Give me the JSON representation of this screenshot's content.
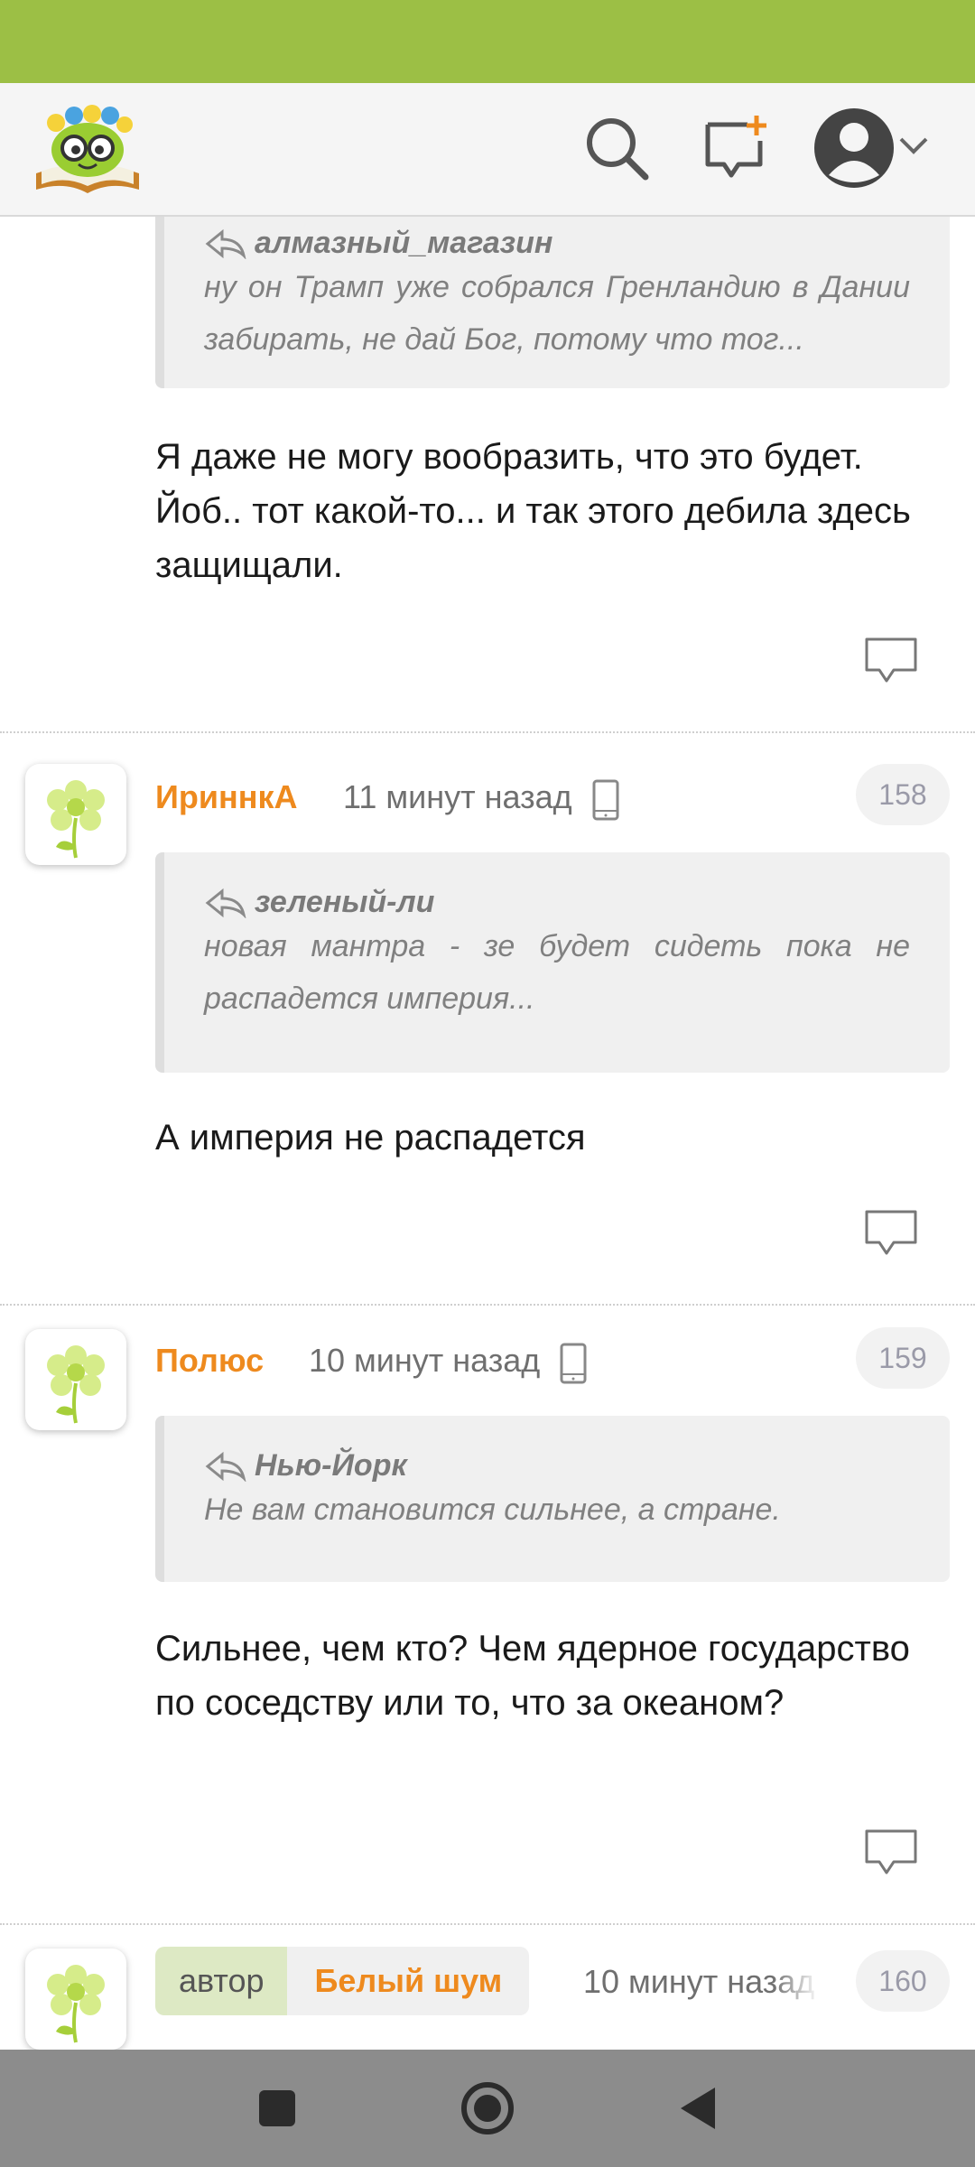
{
  "header": {
    "logo": "smiling-book-logo",
    "search_icon": "search-icon",
    "new_message_icon": "new-message-icon",
    "profile_icon": "profile-icon"
  },
  "comments": [
    {
      "quote_author": "алмазный_магазин",
      "quote_text": "ну он Трамп уже собрался Гренландию в Дании забирать, не дай Бог, потому что тог...",
      "text": "Я даже не могу вообразить, что это будет. Йоб.. тот какой-то... и так этого дебила здесь защищали."
    },
    {
      "username": "ИриннкА",
      "time": "11 минут назад",
      "number": "158",
      "quote_author": "зеленый-ли",
      "quote_text": "новая мантра - зе будет сидеть пока не распадется империя...",
      "text": "А империя не распадется"
    },
    {
      "username": "Полюс",
      "time": "10 минут назад",
      "number": "159",
      "quote_author": "Нью-Йорк",
      "quote_text": "Не вам становится сильнее, а стране.",
      "text": "Сильнее, чем кто? Чем ядерное государство по соседству или то, что за океаном?"
    },
    {
      "author_label": "автор",
      "username": "Белый шум",
      "time": "10 минут назад",
      "number": "160"
    }
  ],
  "colors": {
    "status_bar": "#9cbf45",
    "username": "#ee8a1e",
    "nav_bar": "#8c8c8c"
  }
}
